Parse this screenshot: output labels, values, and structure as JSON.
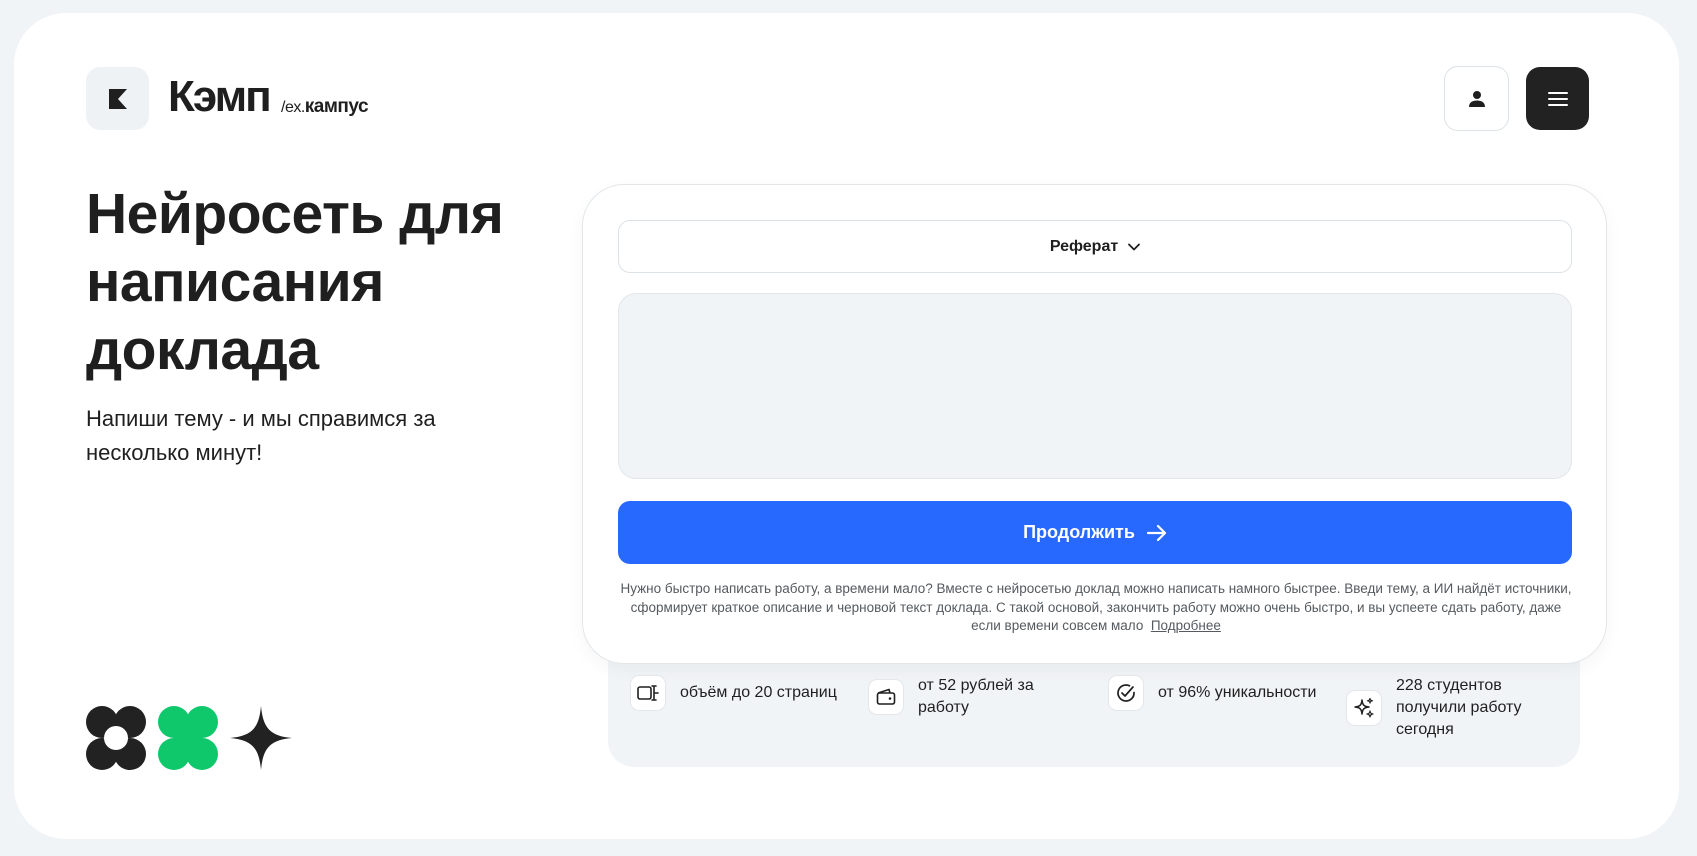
{
  "header": {
    "brand_name": "Кэмп",
    "brand_sub_prefix": "/ex.",
    "brand_sub_name": "кампус",
    "profile_icon": "user-icon",
    "menu_icon": "hamburger-menu-icon"
  },
  "hero": {
    "title": "Нейросеть для написания доклада",
    "subtitle": "Напиши тему - и мы справимся за несколько минут!"
  },
  "form": {
    "work_type": "Реферат",
    "topic_value": "",
    "continue_label": "Продолжить",
    "description": "Нужно быстро написать работу, а времени мало? Вместе с нейросетью доклад можно написать намного быстрее. Введи тему, а ИИ найдёт источники, сформирует краткое описание и черновой текст доклада. С такой основой, закончить работу можно очень быстро, и вы успеете сдать работу, даже если времени совсем мало",
    "more_link": "Подробнее"
  },
  "stats": [
    {
      "icon": "pages-icon",
      "text": "объём до 20 страниц"
    },
    {
      "icon": "wallet-icon",
      "text": "от 52 рублей за работу"
    },
    {
      "icon": "check-circle-icon",
      "text": "от 96% уникальности"
    },
    {
      "icon": "sparkle-icon",
      "text": "228 студентов получили работу сегодня"
    }
  ],
  "colors": {
    "accent": "#2768fe",
    "green": "#0fc86b",
    "dark": "#222222",
    "panel_bg": "#f1f4f7"
  }
}
